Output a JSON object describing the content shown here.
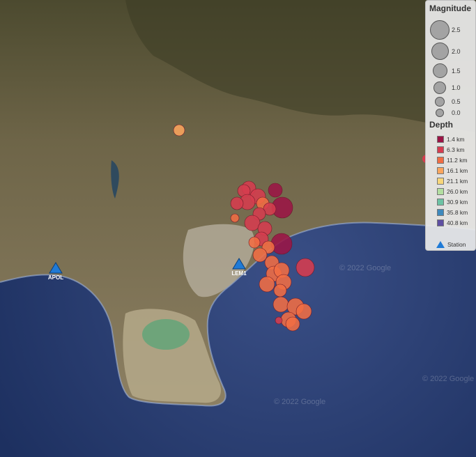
{
  "map": {
    "watermark": "© 2022 Google",
    "stations": [
      {
        "id": "APOL",
        "name": "APOL"
      },
      {
        "id": "LEM1",
        "name": "LEM1"
      }
    ]
  },
  "legend": {
    "magnitude_title": "Magnitude",
    "magnitudes": [
      "2.5",
      "2.0",
      "1.5",
      "1.0",
      "0.5",
      "0.0"
    ],
    "depth_title": "Depth",
    "depths": [
      {
        "label": "1.4 km",
        "color": "#9b1445"
      },
      {
        "label": "6.3 km",
        "color": "#d63c4f"
      },
      {
        "label": "11.2 km",
        "color": "#f16d43"
      },
      {
        "label": "16.1 km",
        "color": "#fca55d"
      },
      {
        "label": "21.1 km",
        "color": "#f8d67a"
      },
      {
        "label": "26.0 km",
        "color": "#b2dea0"
      },
      {
        "label": "30.9 km",
        "color": "#6cc2a4"
      },
      {
        "label": "35.8 km",
        "color": "#3e89bd"
      },
      {
        "label": "40.8 km",
        "color": "#5e4fa2"
      }
    ],
    "station_label": "Station"
  }
}
